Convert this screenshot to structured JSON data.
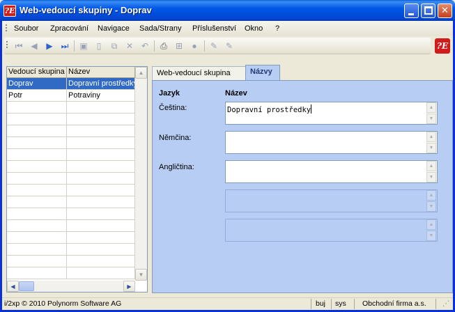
{
  "window": {
    "title": "Web-vedoucí skupiny - Doprav",
    "app_icon": "polynorm-logo"
  },
  "menubar": {
    "items": [
      "Soubor",
      "Zpracování",
      "Navigace",
      "Sada/Strany",
      "Příslušenství",
      "Okno",
      "?"
    ]
  },
  "toolbar": {
    "icons": [
      "first-record-icon",
      "prev-record-icon",
      "next-record-icon",
      "last-record-icon",
      "save-icon",
      "new-icon",
      "copy-icon",
      "delete-icon",
      "undo-icon",
      "print-icon",
      "tree-icon",
      "stop-icon",
      "edit-icon",
      "edit2-icon"
    ]
  },
  "grid": {
    "columns": [
      "Vedoucí skupina",
      "Název"
    ],
    "rows": [
      {
        "code": "Doprav",
        "name": "Dopravní prostředky",
        "selected": true
      },
      {
        "code": "Potr",
        "name": "Potraviny",
        "selected": false
      }
    ]
  },
  "tabs": {
    "inactive": "Web-vedoucí skupina",
    "active": "Názvy"
  },
  "panel": {
    "col_language": "Jazyk",
    "col_name": "Název",
    "rows": [
      {
        "label": "Čeština:",
        "value": "Dopravní prostředky",
        "enabled": true
      },
      {
        "label": "Němčina:",
        "value": "",
        "enabled": true
      },
      {
        "label": "Angličtina:",
        "value": "",
        "enabled": true
      },
      {
        "label": "",
        "value": "",
        "enabled": false
      },
      {
        "label": "",
        "value": "",
        "enabled": false
      }
    ]
  },
  "statusbar": {
    "copyright": "i/2xp © 2010 Polynorm Software AG",
    "mode": "buj",
    "user": "sys",
    "company": "Obchodní firma a.s."
  },
  "colors": {
    "selection": "#316ac5",
    "panel": "#b7cdf3",
    "titlebar": "#0058e6"
  }
}
